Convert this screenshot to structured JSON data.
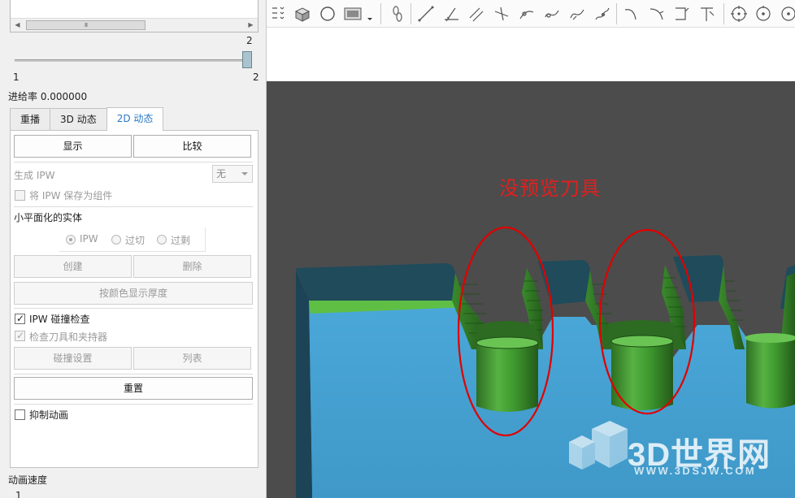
{
  "slider": {
    "max_label": "2",
    "min_label": "1",
    "current_label": "2",
    "value": 2,
    "min": 1,
    "max": 2
  },
  "listbox": {
    "scroll_grip": "III"
  },
  "feed_rate": {
    "label": "进给率 0.000000"
  },
  "tabs": [
    {
      "label": "重播",
      "active": false
    },
    {
      "label": "3D 动态",
      "active": false
    },
    {
      "label": "2D 动态",
      "active": true
    }
  ],
  "panel": {
    "display_button": "显示",
    "compare_button": "比较",
    "generate_ipw_label": "生成 IPW",
    "generate_ipw_value": "无",
    "save_ipw_label": "将 IPW 保存为组件",
    "facet_solid_label": "小平面化的实体",
    "radio_options": [
      {
        "label": "IPW",
        "selected": true
      },
      {
        "label": "过切",
        "selected": false
      },
      {
        "label": "过剩",
        "selected": false
      }
    ],
    "create_button": "创建",
    "delete_button": "删除",
    "color_thickness_button": "按颜色显示厚度",
    "ipw_collision_label": "IPW 碰撞检查",
    "check_tool_label": "检查刀具和夹持器",
    "collision_settings_button": "碰撞设置",
    "list_button": "列表",
    "reset_button": "重置",
    "suppress_anim_label": "抑制动画"
  },
  "animation_speed": {
    "label": "动画速度",
    "min_label": "1"
  },
  "viewport": {
    "annotation": "没预览刀具",
    "annotation_color": "#e02020",
    "background_color": "#4c4c4c",
    "stock_color": "#46a3d2",
    "tool_color": "#3f9a2f",
    "watermark_text": "3D世界网",
    "watermark_url": "WWW.3DSJW.COM"
  },
  "toolbar_icons": [
    "point-set-icon",
    "block-icon",
    "circle-icon",
    "display-icon",
    "dropdown-icon",
    "chain-icon",
    "line-icon",
    "angle-line-icon",
    "parallel-line-icon",
    "perpendicular-line-icon",
    "arc-point-icon",
    "curve-icon",
    "spline-icon",
    "helix-icon",
    "arc-icon",
    "fillet-icon",
    "chamfer-icon",
    "trim-icon",
    "circle-center-icon",
    "circle-three-point-icon",
    "circle-tangent-icon"
  ]
}
